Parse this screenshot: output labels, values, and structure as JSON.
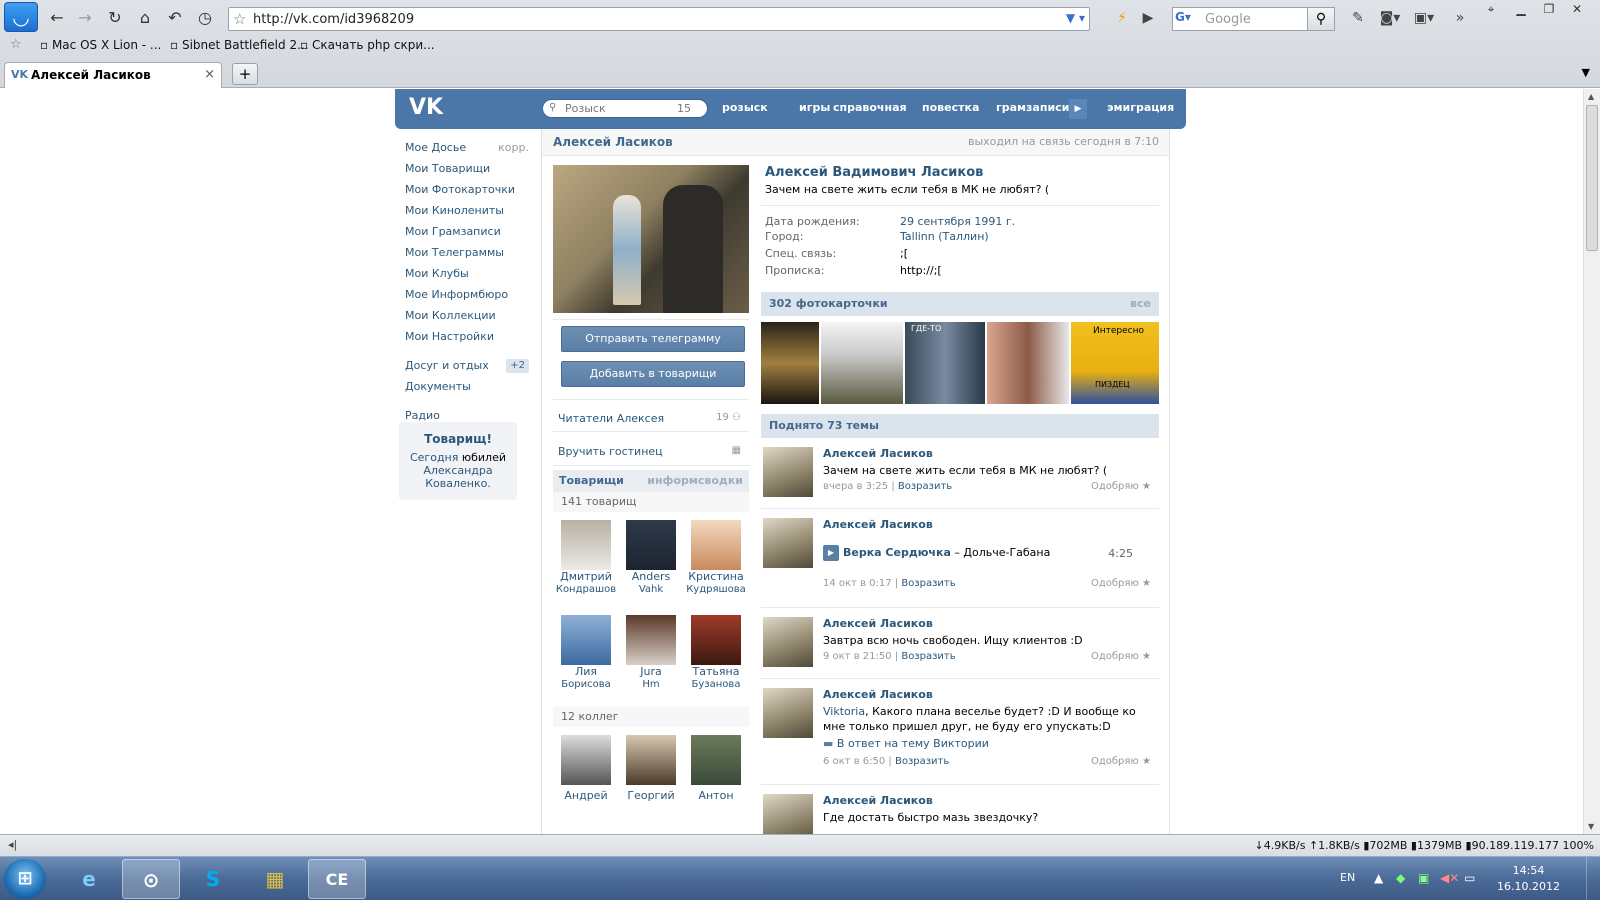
{
  "browser": {
    "url": "http://vk.com/id3968209",
    "search_placeholder": "Google",
    "bookmarks": [
      "Mac OS X Lion - ...",
      "Sibnet Battlefield 2...",
      "Скачать php скри..."
    ],
    "tab_title": "Алексей Ласиков",
    "tab_close": "×",
    "new_tab": "+",
    "status_left": "◂|",
    "status_right": "↓4.9KB/s  ↑1.8KB/s  ▮702MB  ▮1379MB  ▮90.189.119.177",
    "zoom": "100%"
  },
  "vk": {
    "logo": "VK",
    "search_placeholder": "Розыск",
    "search_count": "15",
    "nav": [
      "розыск",
      "игры",
      "справочная",
      "повестка",
      "грамзаписи",
      "эмиграция"
    ],
    "left_menu": [
      {
        "label": "Мое Досье",
        "sub": "корр."
      },
      {
        "label": "Мои Товарищи"
      },
      {
        "label": "Мои Фотокарточки"
      },
      {
        "label": "Мои Кинолениты"
      },
      {
        "label": "Мои Грамзаписи"
      },
      {
        "label": "Мои Телеграммы"
      },
      {
        "label": "Мои Клубы"
      },
      {
        "label": "Мое Информбюро"
      },
      {
        "label": "Мои Коллекции"
      },
      {
        "label": "Мои Настройки"
      }
    ],
    "left_menu2": [
      {
        "label": "Досуг и отдых",
        "badge": "+2"
      },
      {
        "label": "Документы"
      }
    ],
    "left_menu3": [
      {
        "label": "Радио"
      }
    ],
    "promo": {
      "title": "Товарищ!",
      "text1": "Сегодня",
      "text2": "юбилей",
      "text3": "Александра",
      "text4": "Коваленко."
    },
    "profile": {
      "header_name": "Алексей Ласиков",
      "last_seen": "выходил на связь сегодня в 7:10",
      "full_name": "Алексей Вадимович Ласиков",
      "status": "Зачем на свете жить если тебя в МК не любят? (",
      "fields": [
        {
          "k": "Дата рождения:",
          "v": "29 сентября 1991 г."
        },
        {
          "k": "Город:",
          "v": "Tallinn (Таллин)"
        },
        {
          "k": "Спец. связь:",
          "v": ";["
        },
        {
          "k": "Прописка:",
          "v": "http://;["
        }
      ],
      "btn_message": "Отправить телеграмму",
      "btn_add": "Добавить в товарищи",
      "readers": "Читатели Алексея",
      "readers_count": "19",
      "gift": "Вручить гостинец",
      "friends_head": "Товарищи",
      "friends_link": "информсводки",
      "friends_count": "141 товарищ",
      "friends": [
        {
          "n1": "Дмитрий",
          "n2": "Кондрашов"
        },
        {
          "n1": "Anders",
          "n2": "Vahk"
        },
        {
          "n1": "Кристина",
          "n2": "Кудряшова"
        },
        {
          "n1": "Лия",
          "n2": "Борисова"
        },
        {
          "n1": "Jura",
          "n2": "Hm"
        },
        {
          "n1": "Татьяна",
          "n2": "Бузанова"
        }
      ],
      "colleagues_count": "12 коллег",
      "colleagues": [
        {
          "n1": "Андрей"
        },
        {
          "n1": "Георгий"
        },
        {
          "n1": "Антон"
        }
      ],
      "photos_head": "302 фотокарточки",
      "photos_all": "все",
      "photo_captions": [
        "ГДЕ-ТО",
        "Интересно",
        "ПИЗДЕЦ"
      ],
      "topics_head": "Поднято 73 темы",
      "posts": [
        {
          "author": "Алексей Ласиков",
          "text": "Зачем на свете жить если тебя в МК не любят? (",
          "date": "вчера в 3:25",
          "reply": "Возразить",
          "like": "Одобряю"
        },
        {
          "author": "Алексей Ласиков",
          "audio_artist": "Верка Сердючка",
          "audio_title": " – Дольче-Габана",
          "audio_dur": "4:25",
          "date": "14 окт в 0:17",
          "reply": "Возразить",
          "like": "Одобряю"
        },
        {
          "author": "Алексей Ласиков",
          "text": "Завтра всю ночь свободен. Ищу клиентов :D",
          "date": "9 окт в 21:50",
          "reply": "Возразить",
          "like": "Одобряю"
        },
        {
          "author": "Алексей Ласиков",
          "mention": "Viktoria",
          "text": ", Какого плана веселье будет? :D И вообще ко мне только пришел друг, не буду его упускать:D",
          "in_reply": "В ответ на тему Виктории",
          "date": "6 окт в 6:50",
          "reply": "Возразить",
          "like": "Одобряю"
        },
        {
          "author": "Алексей Ласиков",
          "text": "Где достать быстро мазь звездочку?"
        }
      ]
    }
  },
  "taskbar": {
    "lang": "EN",
    "time": "14:54",
    "date": "16.10.2012",
    "apps": [
      "e",
      "⊙",
      "S",
      "▦",
      "CE"
    ]
  },
  "colors": {
    "vk_blue": "#4a76a8",
    "link": "#2b587a",
    "header_bg": "#dbe3ec"
  }
}
